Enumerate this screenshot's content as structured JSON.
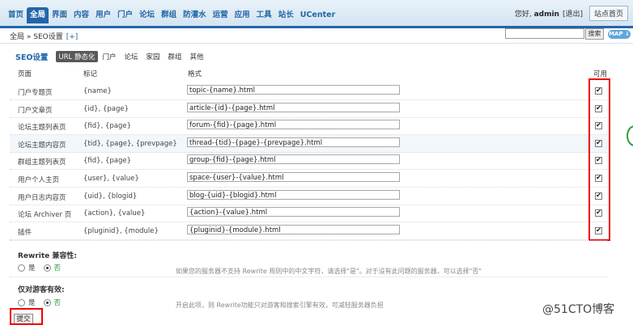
{
  "nav": [
    "首页",
    "全局",
    "界面",
    "内容",
    "用户",
    "门户",
    "论坛",
    "群组",
    "防灌水",
    "运营",
    "应用",
    "工具",
    "站长",
    "UCenter"
  ],
  "nav_active": 1,
  "user": {
    "greeting": "您好,",
    "name": "admin",
    "logout": "[退出]",
    "site_home": "站点首页"
  },
  "breadcrumb": {
    "path": "全局 » SEO设置",
    "plus": "[+]"
  },
  "search": {
    "button": "搜索",
    "map": "MAP ↓"
  },
  "tabs": {
    "title": "SEO设置",
    "items": [
      "URL 静态化",
      "门户",
      "论坛",
      "家园",
      "群组",
      "其他"
    ],
    "active": 0
  },
  "table": {
    "headers": {
      "page": "页面",
      "mark": "标记",
      "format": "格式",
      "enabled": "可用"
    },
    "rows": [
      {
        "page": "门户专题页",
        "mark": "{name}",
        "format": "topic-{name}.html",
        "checked": true
      },
      {
        "page": "门户文章页",
        "mark": "{id}, {page}",
        "format": "article-{id}-{page}.html",
        "checked": true
      },
      {
        "page": "论坛主题列表页",
        "mark": "{fid}, {page}",
        "format": "forum-{fid}-{page}.html",
        "checked": true
      },
      {
        "page": "论坛主题内容页",
        "mark": "{tid}, {page}, {prevpage}",
        "format": "thread-{tid}-{page}-{prevpage}.html",
        "checked": true
      },
      {
        "page": "群组主题列表页",
        "mark": "{fid}, {page}",
        "format": "group-{fid}-{page}.html",
        "checked": true
      },
      {
        "page": "用户个人主页",
        "mark": "{user}, {value}",
        "format": "space-{user}-{value}.html",
        "checked": true
      },
      {
        "page": "用户日志内容页",
        "mark": "{uid}, {blogid}",
        "format": "blog-{uid}-{blogid}.html",
        "checked": true
      },
      {
        "page": "论坛 Archiver 页",
        "mark": "{action}, {value}",
        "format": "{action}-{value}.html",
        "checked": true
      },
      {
        "page": "插件",
        "mark": "{pluginid}, {module}",
        "format": "{pluginid}-{module}.html",
        "checked": true
      }
    ]
  },
  "rewrite": {
    "title": "Rewrite 兼容性:",
    "yes": "是",
    "no": "否",
    "selected": "no",
    "hint": "如果您的服务器不支持 Rewrite 规则中的中文字符，请选择\"是\"。对于没有此问题的服务器，可以选择\"否\""
  },
  "guest": {
    "title": "仅对游客有效:",
    "yes": "是",
    "no": "否",
    "selected": "no",
    "hint": "开启此项，则 Rewrite功能只对游客和搜索引擎有效，可减轻服务器负担"
  },
  "submit": "提交",
  "watermark": "@51CTO博客"
}
